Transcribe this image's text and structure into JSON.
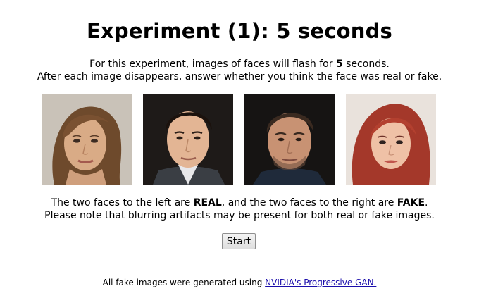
{
  "title": "Experiment (1): 5 seconds",
  "intro": {
    "line1_prefix": "For this experiment, images of faces will flash for ",
    "line1_bold": "5",
    "line1_suffix": " seconds.",
    "line2": "After each image disappears, answer whether you think the face was real or fake."
  },
  "faces": [
    {
      "label": "REAL"
    },
    {
      "label": "REAL"
    },
    {
      "label": "FAKE"
    },
    {
      "label": "FAKE"
    }
  ],
  "note": {
    "line1_part1": "The two faces to the left are ",
    "line1_bold1": "REAL",
    "line1_part2": ", and the two faces to the right are ",
    "line1_bold2": "FAKE",
    "line1_part3": ".",
    "line2": "Please note that blurring artifacts may be present for both real or fake images."
  },
  "start_button": {
    "label": "Start"
  },
  "footer": {
    "prefix": "All fake images were generated using ",
    "link_text": "NVIDIA's Progressive GAN."
  }
}
